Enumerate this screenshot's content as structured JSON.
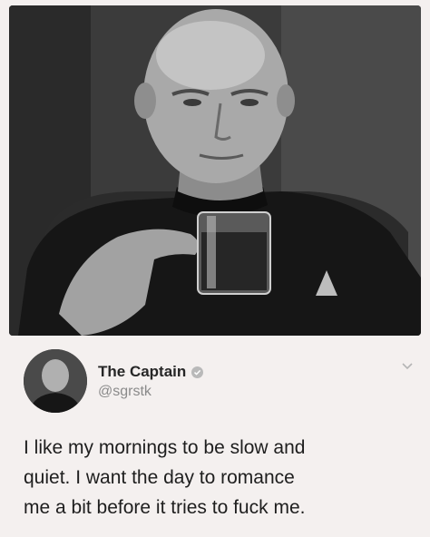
{
  "tweet": {
    "author_name": "The Captain",
    "handle": "@sgrstk",
    "text_lines": [
      "I like my mornings to be slow and",
      "quiet. I want the day to romance",
      "me a bit before it tries to fuck me."
    ]
  },
  "icons": {
    "verified": "verified-badge-icon",
    "more": "chevron-down-icon"
  },
  "colors": {
    "background": "#f4f0ef",
    "name": "#262626",
    "handle": "#8a8a8a",
    "verified_badge": "#b9b9b9"
  }
}
